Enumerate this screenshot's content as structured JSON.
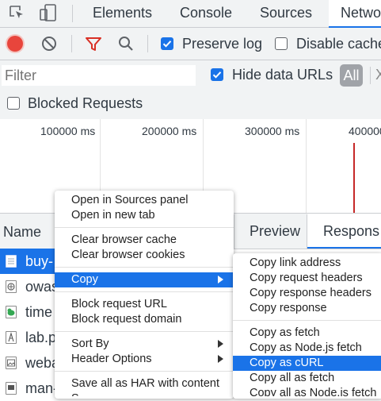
{
  "tabs": [
    {
      "label": "Elements"
    },
    {
      "label": "Console"
    },
    {
      "label": "Sources"
    },
    {
      "label": "Netwo"
    }
  ],
  "toolbar": {
    "preserve_log": {
      "label": "Preserve log",
      "checked": true
    },
    "disable_cache": {
      "label": "Disable cache",
      "checked": false
    }
  },
  "filter": {
    "placeholder": "Filter",
    "hide_data_urls": {
      "label": "Hide data URLs",
      "checked": true
    },
    "all_label": "All",
    "overflow_label": "X"
  },
  "blocked_requests": {
    "label": "Blocked Requests",
    "checked": false
  },
  "timeline": {
    "ticks": [
      "100000 ms",
      "200000 ms",
      "300000 ms",
      "400000"
    ]
  },
  "list": {
    "name_header": "Name",
    "detail_tabs": [
      "Preview",
      "Respons"
    ],
    "rows": [
      {
        "name": "buy-",
        "icon": "document-icon",
        "selected": true
      },
      {
        "name": "owas",
        "icon": "image-icon"
      },
      {
        "name": "time",
        "icon": "leaf-icon"
      },
      {
        "name": "lab.p",
        "icon": "font-icon"
      },
      {
        "name": "weba",
        "icon": "image-icon"
      },
      {
        "name": "man-",
        "icon": "document-icon"
      }
    ]
  },
  "context_menu": {
    "items": [
      {
        "label": "Open in Sources panel"
      },
      {
        "label": "Open in new tab"
      },
      {
        "label": "Clear browser cache"
      },
      {
        "label": "Clear browser cookies"
      },
      {
        "label": "Copy"
      },
      {
        "label": "Block request URL"
      },
      {
        "label": "Block request domain"
      },
      {
        "label": "Sort By"
      },
      {
        "label": "Header Options"
      },
      {
        "label": "Save all as HAR with content"
      },
      {
        "label": "S"
      }
    ]
  },
  "copy_submenu": {
    "items": [
      {
        "label": "Copy link address"
      },
      {
        "label": "Copy request headers"
      },
      {
        "label": "Copy response headers"
      },
      {
        "label": "Copy response"
      },
      {
        "label": "Copy as fetch"
      },
      {
        "label": "Copy as Node.js fetch"
      },
      {
        "label": "Copy as cURL"
      },
      {
        "label": "Copy all as fetch"
      },
      {
        "label": "Copy all as Node.js fetch"
      }
    ]
  },
  "colors": {
    "accent": "#1a73e8",
    "record": "#e8453c",
    "filter_icon": "#d93025",
    "timeline_marker": "#c62828"
  }
}
